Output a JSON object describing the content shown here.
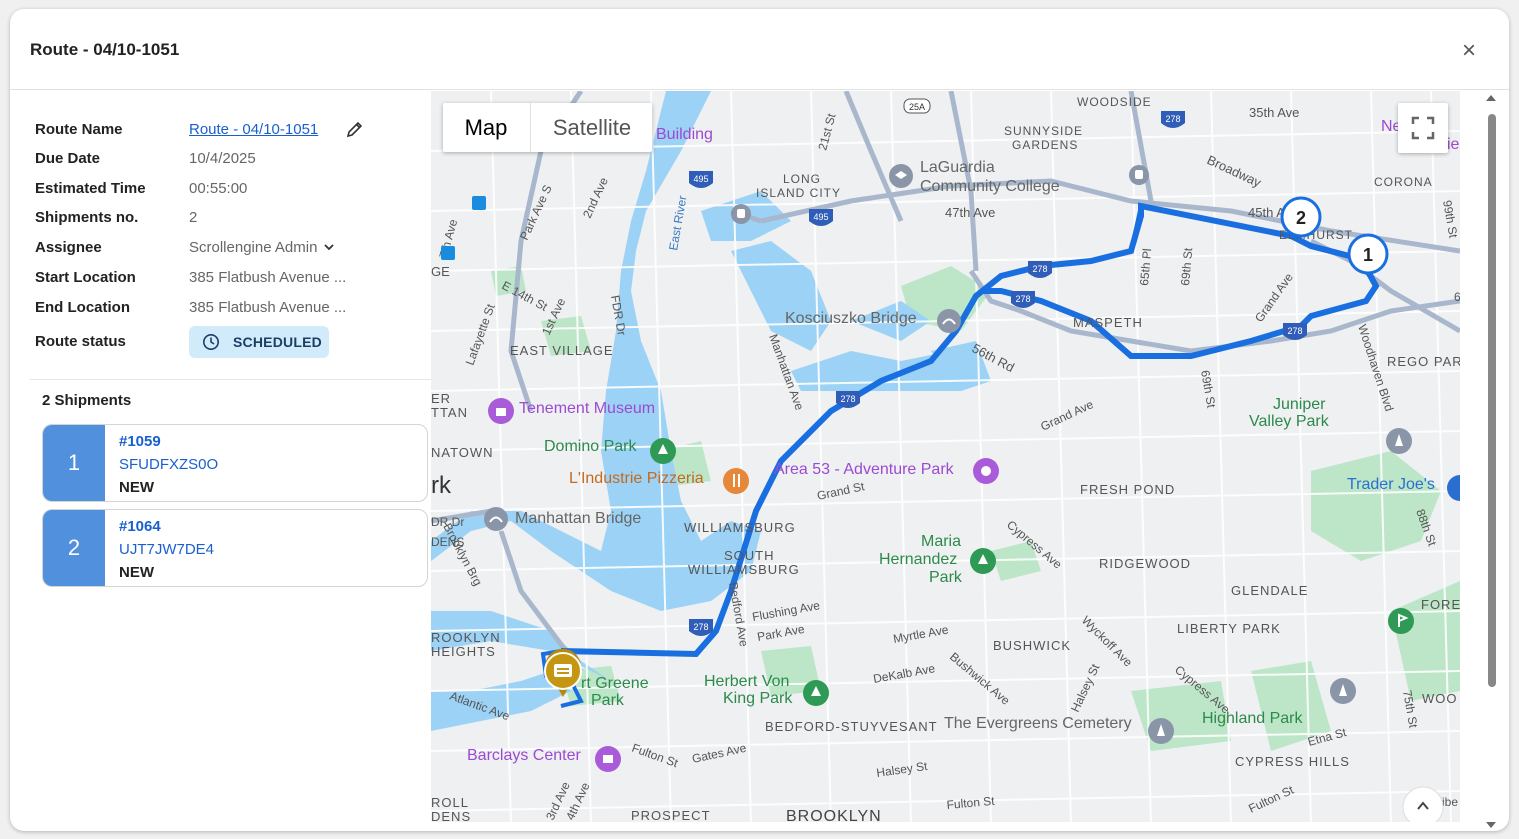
{
  "modal": {
    "title": "Route - 04/10-1051",
    "close_label": "×"
  },
  "details": {
    "route_name": {
      "label": "Route Name",
      "value": "Route - 04/10-1051"
    },
    "due_date": {
      "label": "Due Date",
      "value": "10/4/2025"
    },
    "estimated_time": {
      "label": "Estimated Time",
      "value": "00:55:00"
    },
    "shipments_no": {
      "label": "Shipments no.",
      "value": "2"
    },
    "assignee": {
      "label": "Assignee",
      "value": "Scrollengine Admin",
      "icon": "chevron-down-icon"
    },
    "start_location": {
      "label": "Start Location",
      "value": "385 Flatbush Avenue ..."
    },
    "end_location": {
      "label": "End Location",
      "value": "385 Flatbush Avenue ..."
    },
    "route_status": {
      "label": "Route status",
      "value": "SCHEDULED",
      "icon": "clock-icon",
      "color": "#d2ebfb"
    }
  },
  "shipments": {
    "heading": "2 Shipments",
    "items": [
      {
        "seq": "1",
        "number": "#1059",
        "code": "SFUDFXZS0O",
        "status": "NEW"
      },
      {
        "seq": "2",
        "number": "#1064",
        "code": "UJT7JW7DE4",
        "status": "NEW"
      }
    ]
  },
  "map": {
    "type_options": [
      "Map",
      "Satellite"
    ],
    "selected_type": "Map",
    "route_color": "#1a6fe0",
    "water_color": "#9cd2f5",
    "park_color": "#bde6c8",
    "labels": {
      "woodside": "WOODSIDE",
      "sunnyside": "SUNNYSIDE",
      "gardens": "GARDENS",
      "long": "LONG",
      "island_city": "ISLAND CITY",
      "laguardia1": "LaGuardia",
      "laguardia2": "Community College",
      "building": "Building",
      "ave47": "47th Ave",
      "ave35": "35th Ave",
      "ave45": "45th Ave",
      "broadway": "Broadway",
      "elmhurst": "ELMHURST",
      "corona": "CORONA",
      "st21": "21st St",
      "eastriver": "East River",
      "park_ave_s": "Park Ave S",
      "ave2": "2nd Ave",
      "ave7": "7th Ave",
      "e14": "E 14th St",
      "ave1": "1st Ave",
      "lafayette": "Lafayette St",
      "fdr": "FDR Dr",
      "eastvillage": "EAST VILLAGE",
      "ge": "GE",
      "kosciuszko": "Kosciuszko Bridge",
      "maspeth": "MASPETH",
      "rd56": "56th Rd",
      "manhattan_ave": "Manhattan Ave",
      "pl65": "65th Pl",
      "st69": "69th St",
      "grand_ave": "Grand Ave",
      "woodhaven": "Woodhaven Blvd",
      "rego": "REGO PAR",
      "tenement": "Tenement Museum",
      "er_ttan1": "ER",
      "er_ttan2": "TTAN",
      "domino": "Domino Park",
      "natown": "NATOWN",
      "industrie": "L'Industrie Pizzeria",
      "area53": "Area 53 - Adventure Park",
      "juniper1": "Juniper",
      "juniper2": "Valley Park",
      "grand_st": "Grand St",
      "fresh_pond": "FRESH POND",
      "traderjoes": "Trader Joe's",
      "rk": "rk",
      "manhattan_bridge": "Manhattan Bridge",
      "williamsburg": "WILLIAMSBURG",
      "south": "SOUTH",
      "s_williamsburg": "WILLIAMSBURG",
      "maria1": "Maria",
      "maria2": "Hernandez",
      "maria3": "Park",
      "cypress_ave": "Cypress Ave",
      "ridgewood": "RIDGEWOOD",
      "glendale": "GLENDALE",
      "st88": "88th St",
      "fore": "FORE",
      "flushing": "Flushing Ave",
      "park_ave": "Park Ave",
      "bedford_ave": "Bedford Ave",
      "myrtle": "Myrtle Ave",
      "wyckoff": "Wyckoff Ave",
      "liberty": "LIBERTY PARK",
      "bushwick": "BUSHWICK",
      "brooklyn_br": "Brooklyn Brg",
      "rooklyn": "ROOKLYN",
      "heights": "HEIGHTS",
      "dr_dr": "DR Dr",
      "dens1": "DENS",
      "fort_greene1": "rt Greene",
      "fort_greene2": "Park",
      "herbert1": "Herbert Von",
      "herbert2": "King Park",
      "dekalb": "DeKalb Ave",
      "bushwick_ave": "Bushwick Ave",
      "halsey_st_v": "Halsey St",
      "cypress_ave2": "Cypress Ave",
      "highland": "Highland Park",
      "woo": "WOO",
      "atlantic": "Atlantic Ave",
      "bed_stuy": "BEDFORD-STUYVESANT",
      "evergreens": "The Evergreens Cemetery",
      "etna": "Etna St",
      "st75": "75th St",
      "barclays": "Barclays Center",
      "fulton": "Fulton St",
      "gates": "Gates Ave",
      "halsey": "Halsey St",
      "cypress_hills": "CYPRESS HILLS",
      "roll": "ROLL",
      "dens2": "DENS",
      "ave3": "3rd Ave",
      "ave4": "4th Ave",
      "prospect": "PROSPECT",
      "brooklyn": "BROOKLYN",
      "fulton2": "Fulton St",
      "fulton3": "Fulton St",
      "ibe": "ibe",
      "new_k": "New k",
      "ie": "ie",
      "st99": "99th St",
      "h495a": "495",
      "h495b": "495",
      "h278a": "278",
      "h278b": "278",
      "h278c": "278",
      "h278d": "278",
      "h278e": "278",
      "h278f": "278",
      "h25a": "25A",
      "st69b": "69th St",
      "i6": "6"
    },
    "stops": [
      {
        "seq": "1"
      },
      {
        "seq": "2"
      }
    ]
  }
}
